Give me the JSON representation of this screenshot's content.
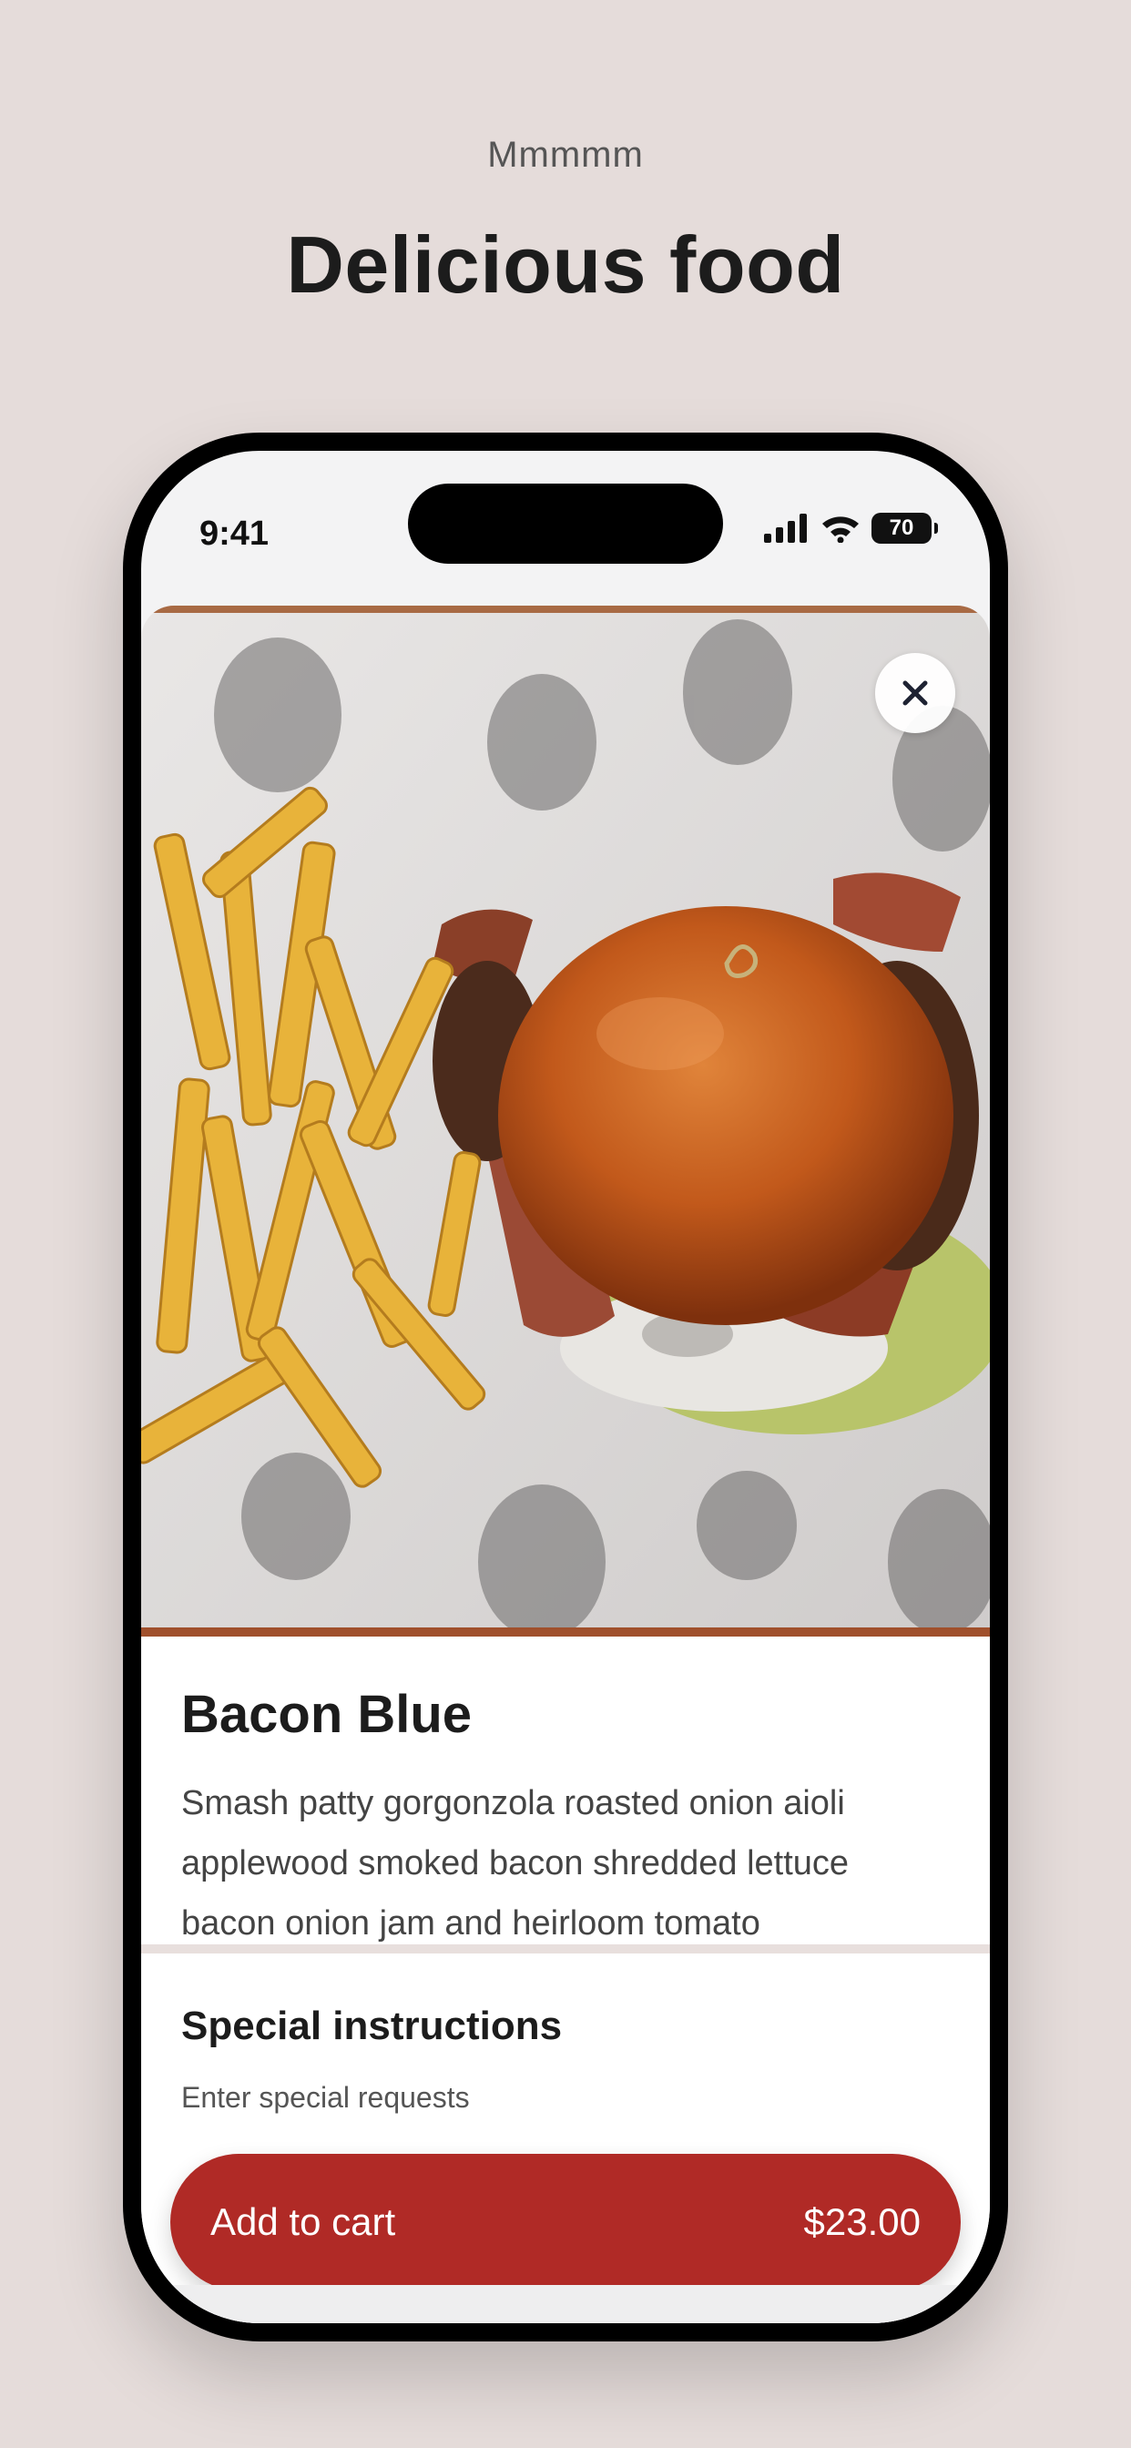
{
  "header": {
    "eyebrow": "Mmmmm",
    "title": "Delicious food"
  },
  "status_bar": {
    "time": "9:41",
    "battery": "70",
    "icons": [
      "signal-icon",
      "wifi-icon",
      "battery-icon"
    ]
  },
  "item": {
    "image_alt": "Burger with fries",
    "title": "Bacon Blue",
    "description": "Smash patty gorgonzola roasted onion aioli applewood smoked bacon shredded lettuce bacon onion jam and heirloom tomato"
  },
  "special": {
    "title": "Special instructions",
    "placeholder": "Enter special requests"
  },
  "cart": {
    "label": "Add to cart",
    "price": "$23.00"
  },
  "colors": {
    "background": "#e5dcda",
    "accent": "#b02a26",
    "text": "#1c1c1c"
  }
}
